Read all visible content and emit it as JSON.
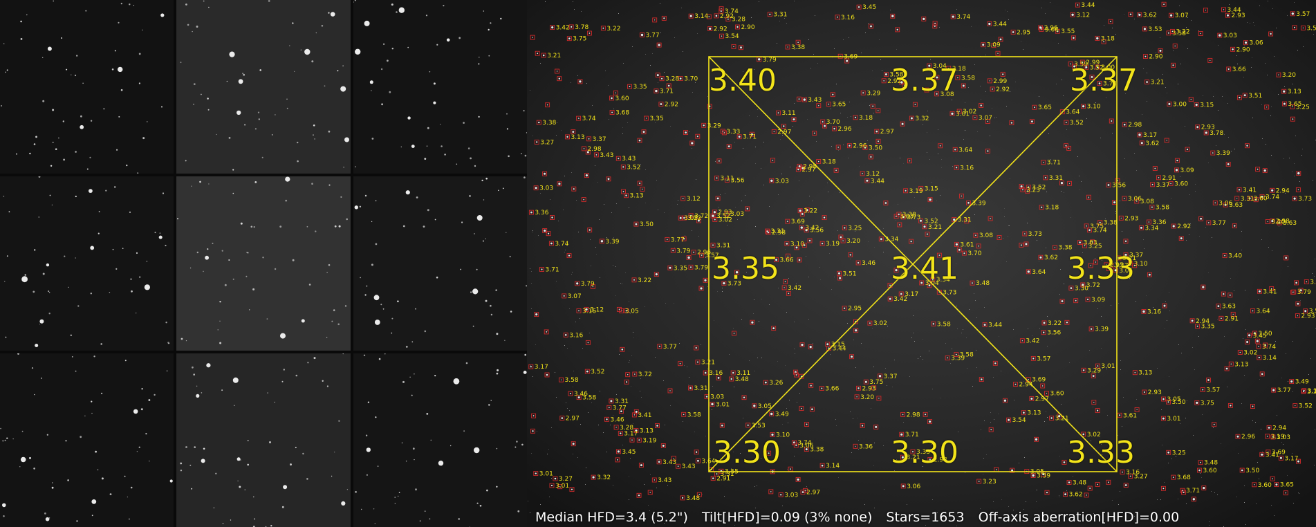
{
  "mosaic": {
    "grid": "3x3",
    "tiles": [
      {
        "name": "top-left",
        "tone": "#121212"
      },
      {
        "name": "top-center",
        "tone": "#2a2a2a"
      },
      {
        "name": "top-right",
        "tone": "#141414"
      },
      {
        "name": "middle-left",
        "tone": "#141414"
      },
      {
        "name": "center",
        "tone": "#323232"
      },
      {
        "name": "middle-right",
        "tone": "#181818"
      },
      {
        "name": "bottom-left",
        "tone": "#131313"
      },
      {
        "name": "bottom-center",
        "tone": "#262626"
      },
      {
        "name": "bottom-right",
        "tone": "#151515"
      }
    ]
  },
  "analysis": {
    "corner_values": {
      "top_left": "3.40",
      "top_center": "3.37",
      "top_right": "3.37",
      "middle_left": "3.35",
      "center": "3.41",
      "middle_right": "3.33",
      "bottom_left": "3.30",
      "bottom_center": "3.30",
      "bottom_right": "3.33"
    },
    "overlay_color": "#f3e41a",
    "marker_color": "#d12a2a",
    "status": {
      "median_hfd": "Median HFD=3.4 (5.2\")",
      "tilt": "Tilt[HFD]=0.09 (3% none)",
      "stars": "Stars=1653",
      "off_axis": "Off-axis aberration[HFD]=0.00"
    }
  }
}
